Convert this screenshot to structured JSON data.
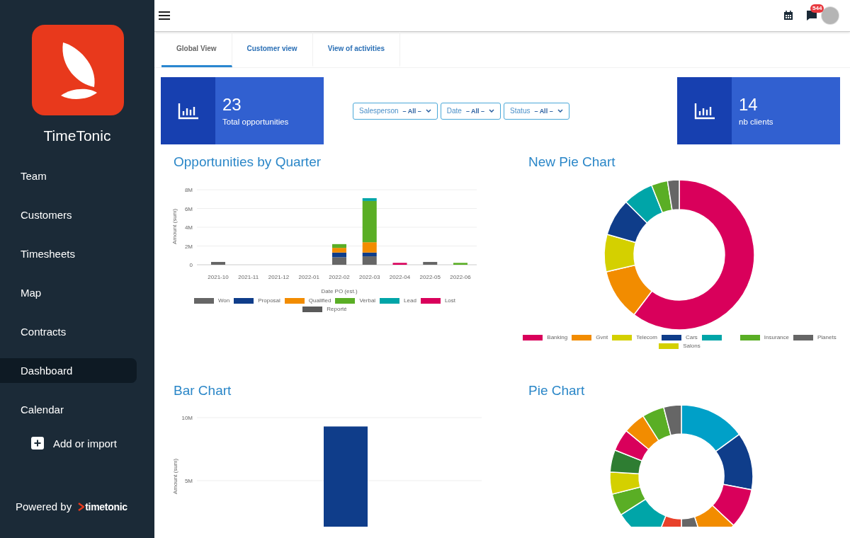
{
  "sidebar": {
    "brand": "TimeTonic",
    "items": [
      {
        "label": "Team",
        "selected": false
      },
      {
        "label": "Customers",
        "selected": false
      },
      {
        "label": "Timesheets",
        "selected": false
      },
      {
        "label": "Map",
        "selected": false
      },
      {
        "label": "Contracts",
        "selected": false
      },
      {
        "label": "Dashboard",
        "selected": true
      },
      {
        "label": "Calendar",
        "selected": false
      }
    ],
    "add_button": "Add or import",
    "footer": {
      "powered_by": "Powered by",
      "logo_text": "timetonic"
    }
  },
  "top_bar": {
    "notification_count": "544"
  },
  "tabs": [
    {
      "label": "Global View",
      "selected": true
    },
    {
      "label": "Customer view",
      "selected": false
    },
    {
      "label": "View of activities",
      "selected": false
    }
  ],
  "kpis": [
    {
      "value": "23",
      "label": "Total opportunities"
    },
    {
      "value": "14",
      "label": "nb clients"
    }
  ],
  "filters": [
    {
      "label": "Salesperson",
      "value": "– All –"
    },
    {
      "label": "Date",
      "value": "– All –"
    },
    {
      "label": "Status",
      "value": "– All –"
    }
  ],
  "charts": [
    {
      "kind": "stacked_bar",
      "title": "Opportunities by Quarter",
      "chart_data": {
        "type": "bar",
        "stacked": true,
        "grid": true,
        "xlabel": "Date PO (est.)",
        "ylabel": "Amount (sum)",
        "categories": [
          "2021-10",
          "2021-11",
          "2021-12",
          "2022-01",
          "2022-02",
          "2022-03",
          "2022-04",
          "2022-05",
          "2022-06"
        ],
        "ylim": [
          0,
          8
        ],
        "yticks": [
          {
            "value": 0,
            "label": "0"
          },
          {
            "value": 2,
            "label": "2M"
          },
          {
            "value": 4,
            "label": "4M"
          },
          {
            "value": 6,
            "label": "6M"
          },
          {
            "value": 8,
            "label": "8M"
          }
        ],
        "series": [
          {
            "name": "Won",
            "color": "#666666",
            "values": [
              0.3,
              null,
              null,
              null,
              0.8,
              0.9,
              null,
              0.3,
              null
            ]
          },
          {
            "name": "Proposal",
            "color": "#0f3d8a",
            "values": [
              null,
              null,
              null,
              null,
              0.5,
              0.4,
              null,
              null,
              null
            ]
          },
          {
            "name": "Qualified",
            "color": "#f28c00",
            "values": [
              null,
              null,
              null,
              null,
              0.5,
              1.1,
              null,
              null,
              null
            ]
          },
          {
            "name": "Verbal",
            "color": "#5aae25",
            "values": [
              null,
              null,
              null,
              null,
              0.4,
              4.4,
              null,
              null,
              0.2
            ]
          },
          {
            "name": "Lead",
            "color": "#00a5a8",
            "values": [
              null,
              null,
              null,
              null,
              null,
              0.3,
              null,
              null,
              null
            ]
          },
          {
            "name": "Lost",
            "color": "#d9005b",
            "values": [
              null,
              null,
              null,
              null,
              null,
              null,
              0.2,
              null,
              null
            ]
          },
          {
            "name": "Reporté",
            "color": "#5a5a5a",
            "values": [
              null,
              null,
              null,
              null,
              null,
              null,
              null,
              null,
              null
            ]
          }
        ]
      }
    },
    {
      "kind": "donut",
      "title": "New Pie Chart",
      "chart_data": {
        "type": "donut",
        "categories": [
          "Banking",
          "Gvnt",
          "Telecom",
          "Cars",
          null,
          "Insurance",
          "Planets",
          "Salons"
        ],
        "values": [
          60,
          11,
          8,
          8,
          6.5,
          3.5,
          2.5,
          0
        ],
        "colors": [
          "#d9005b",
          "#f28c00",
          "#d4d000",
          "#0f3d8a",
          "#00a5a8",
          "#5aae25",
          "#666666",
          "#d4d000"
        ]
      }
    },
    {
      "kind": "bar",
      "title": "Bar Chart",
      "chart_data": {
        "type": "bar",
        "grid": true,
        "ylabel": "Amount (sum)",
        "values": [
          9.3
        ],
        "ylim": [
          0,
          10
        ],
        "yticks": [
          {
            "value": 5,
            "label": "5M"
          },
          {
            "value": 10,
            "label": "10M"
          }
        ]
      }
    },
    {
      "kind": "donut_picture",
      "title": "Pie Chart"
    }
  ]
}
